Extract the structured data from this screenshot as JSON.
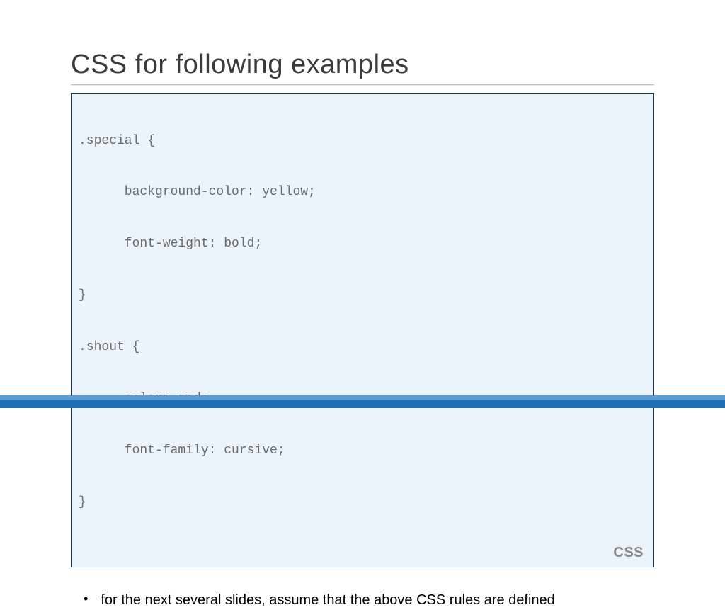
{
  "title": "CSS for following examples",
  "code": {
    "lines": [
      ".special {",
      "      background-color: yellow;",
      "      font-weight: bold;",
      "}",
      ".shout {",
      "      color: red;",
      "      font-family: cursive;",
      "}"
    ],
    "label": "CSS"
  },
  "bullets": [
    "for the next several slides, assume that the above CSS rules are defined"
  ]
}
